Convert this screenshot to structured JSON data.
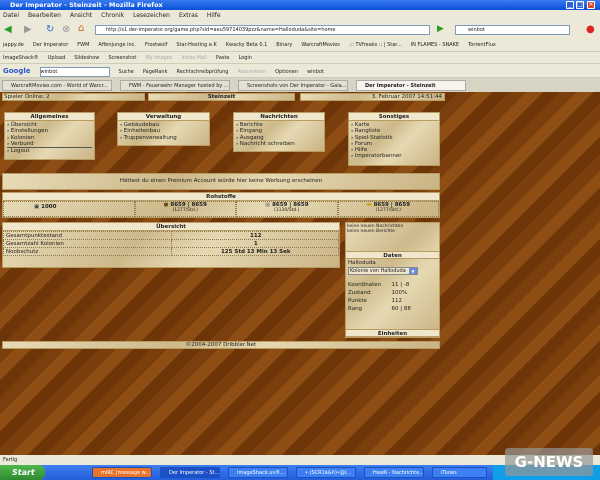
{
  "window": {
    "title": "Der Imperator - Steinzeit - Mozilla Firefox"
  },
  "menu": [
    "Datei",
    "Bearbeiten",
    "Ansicht",
    "Chronik",
    "Lesezeichen",
    "Extras",
    "Hilfe"
  ],
  "url": "http://s1.der-imperator.org/game.php?sid=aeu59714039pzz&name=Halloduda&site=home",
  "search_value": "winbot",
  "bookmarks": [
    "jappy.de",
    "Der Imperator",
    "FWM",
    "Affenjunge inc.",
    "Frostwolf",
    "Star-Hosting e.K",
    "Kwacky Beta 0.1",
    "Binary",
    "WarcraftMovies",
    ".:: TVfreaks :: | Star...",
    "IN FLAMES - SNAKE",
    "TorrentFlux"
  ],
  "imageshack_bar": [
    "ImageShack®",
    "Upload",
    "Slideshow",
    "Screenshot",
    "My Images",
    "Inbox Mail",
    "Paste",
    "Login"
  ],
  "google_bar": {
    "logo": "Google",
    "query": "winbot",
    "items": [
      "Suche",
      "PageRank",
      "Rechtschreibprüfung",
      "Abonnieren",
      "Optionen",
      "winbot"
    ]
  },
  "tabs": [
    "WarcraftMovies.com - World of Warcr...",
    "FWM - Feuerwehr Manager hosted by ...",
    "Screenshots von Der Imperator - Gala...",
    "Der Imperator - Steinzeit"
  ],
  "game": {
    "players_online": "Spieler Online: 2",
    "era": "Steinzeit",
    "datetime": "3. Februar 2007 14:51:44",
    "menus": [
      {
        "title": "Allgemeines",
        "items": [
          "Übersicht",
          "Einstellungen",
          "Kolonien",
          "Verbund",
          "Logout"
        ]
      },
      {
        "title": "Verwaltung",
        "items": [
          "Gebäudebau",
          "Einheitenbau",
          "Truppenverwaltung"
        ]
      },
      {
        "title": "Nachrichten",
        "items": [
          "Berichte",
          "Eingang",
          "Ausgang",
          "Nachricht schreiben"
        ]
      },
      {
        "title": "Sonstiges",
        "items": [
          "Karte",
          "Rangliste",
          "Spiel-Statistik",
          "Forum",
          "Hilfe",
          "Imperatorbanner"
        ]
      }
    ],
    "ad": "Hättest du einen Premium Account würde hier keine Werbung erscheinen",
    "resources": {
      "title": "Rohstoffe",
      "items": [
        {
          "value": "1000",
          "sub": ""
        },
        {
          "value": "8659 | 8659",
          "sub": "(1277/Std.)"
        },
        {
          "value": "8659 | 8659",
          "sub": "(1130/Std.)"
        },
        {
          "value": "8659 | 8659",
          "sub": "(1277/Std.)"
        }
      ]
    },
    "overview": {
      "title": "Übersicht",
      "rows": [
        [
          "Gesamtpunktestand",
          "112"
        ],
        [
          "Gesamtzahl Kolonien",
          "1"
        ],
        [
          "Noobschutz",
          "125 Std 13 Min 13 Sek"
        ]
      ]
    },
    "notices": [
      "keine neuen Nachrichten",
      "keine neuen Berichte"
    ],
    "daten": {
      "title": "Daten",
      "player": "Halloduda",
      "colony_select": "Kolonie von Halloduda",
      "rows": [
        [
          "Koordinaten",
          "11 | -8"
        ],
        [
          "Zustand",
          "100%"
        ],
        [
          "Punkte",
          "112"
        ],
        [
          "Rang",
          "60 | 88"
        ]
      ],
      "units_title": "Einheiten"
    },
    "footer": "©2004-2007 Dribbler.Net"
  },
  "status": "Fertig",
  "taskbar": {
    "start": "Start",
    "tasks": [
      "mIRC [message w...",
      "Der Imperator - St...",
      "ImageShack.us®...",
      "•.(SCR1ã&ñ)•@(...",
      "Haw6 - Nachrichte...",
      "iTunes"
    ]
  },
  "watermark": "G-NEWS"
}
